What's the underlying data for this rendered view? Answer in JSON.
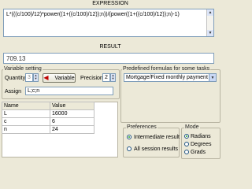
{
  "expression": {
    "header": "EXPRESSION",
    "text": "L*(((c/100)/12)*power((1+((c/100)/12));n))/(power((1+((c/100)/12));n)-1)"
  },
  "result": {
    "header": "RESULT",
    "value": "709.13"
  },
  "variable_setting": {
    "title": "Variable setting",
    "quantity_label": "Quantity",
    "quantity_value": "3",
    "variable_button": "Variable",
    "precision_label": "Precision",
    "precision_value": "2",
    "assign_label": "Assign",
    "assign_value": "L;c;n"
  },
  "variables_table": {
    "headers": [
      "Name",
      "Value"
    ],
    "rows": [
      [
        "L",
        "16000"
      ],
      [
        "c",
        "6"
      ],
      [
        "n",
        "24"
      ]
    ]
  },
  "predefined": {
    "title": "Predefined formulas for some tasks",
    "selected": "Mortgage/Fixed monthly payment P."
  },
  "preferences": {
    "title": "Preferences",
    "options": [
      "Intermediate result",
      "All session results"
    ],
    "selected_index": 0
  },
  "mode": {
    "title": "Mode",
    "options": [
      "Radians",
      "Degrees",
      "Grads"
    ],
    "selected_index": 0
  },
  "colors": {
    "window_bg": "#ece9d8",
    "arrow_red": "#c00000",
    "radio_green": "#21a121"
  },
  "icons": [
    "left-arrow-icon",
    "spin-up-icon",
    "spin-down-icon",
    "dropdown-arrow-icon",
    "scroll-up-icon",
    "scroll-down-icon"
  ]
}
